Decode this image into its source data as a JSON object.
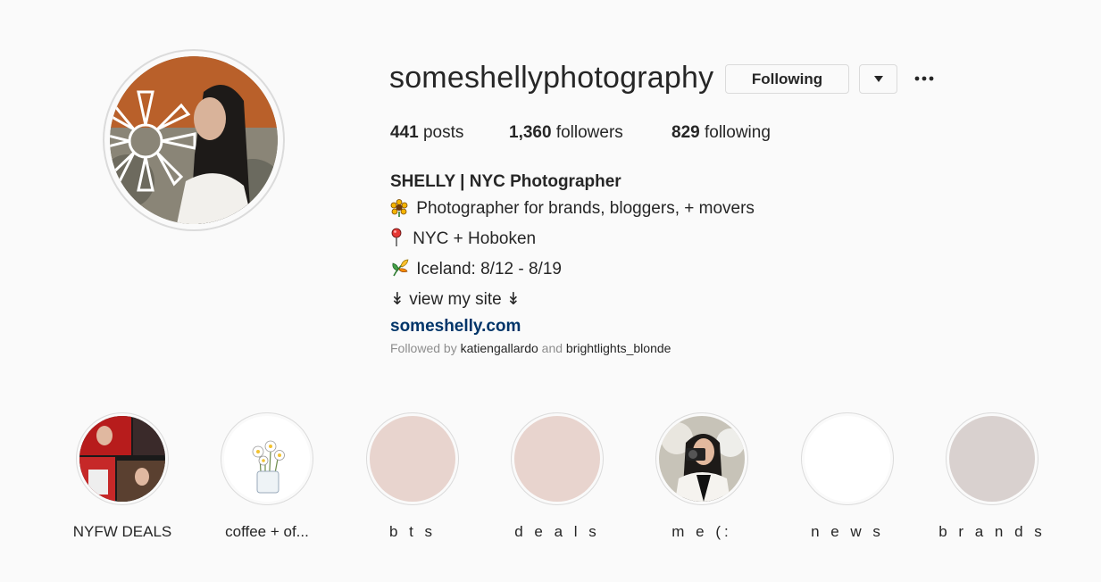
{
  "profile": {
    "username": "someshellyphotography",
    "following_button": "Following"
  },
  "stats": {
    "posts_count": "441",
    "posts_label": "posts",
    "followers_count": "1,360",
    "followers_label": "followers",
    "following_count": "829",
    "following_label": "following"
  },
  "bio": {
    "name": "SHELLY | NYC Photographer",
    "line1": "Photographer for brands, bloggers, + movers",
    "line2": "NYC + Hoboken",
    "line3": "Iceland: 8/12 - 8/19",
    "line4": "↡ view my site ↡",
    "link": "someshelly.com"
  },
  "followed_by": {
    "prefix": "Followed by",
    "user1": "katiengallardo",
    "conjunction": "and",
    "user2": "brightlights_blonde"
  },
  "highlights": [
    {
      "label": "NYFW DEALS"
    },
    {
      "label": "coffee + of..."
    },
    {
      "label": "b t s",
      "color": "#e8d4ce"
    },
    {
      "label": "d e a l s",
      "color": "#e8d4ce"
    },
    {
      "label": "m e (:"
    },
    {
      "label": "n e w s",
      "color": "#ffffff"
    },
    {
      "label": "b r a n d s",
      "color": "#d9d1cf"
    }
  ],
  "icons": {
    "bio_line1": "sunflower-icon",
    "bio_line2": "round-pushpin-icon",
    "bio_line3": "herb-icon"
  }
}
